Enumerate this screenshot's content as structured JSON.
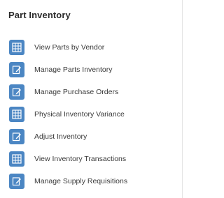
{
  "panel": {
    "title": "Part Inventory"
  },
  "menu": {
    "items": [
      {
        "label": "View Parts by Vendor",
        "icon": "grid-report-icon"
      },
      {
        "label": "Manage Parts Inventory",
        "icon": "edit-form-icon"
      },
      {
        "label": "Manage Purchase Orders",
        "icon": "edit-form-icon"
      },
      {
        "label": "Physical Inventory Variance",
        "icon": "grid-report-icon"
      },
      {
        "label": "Adjust Inventory",
        "icon": "edit-form-icon"
      },
      {
        "label": "View Inventory Transactions",
        "icon": "grid-report-icon"
      },
      {
        "label": "Manage Supply Requisitions",
        "icon": "edit-form-icon"
      }
    ]
  },
  "colors": {
    "icon_background": "#4b86c3",
    "text": "#3a3a3a"
  }
}
